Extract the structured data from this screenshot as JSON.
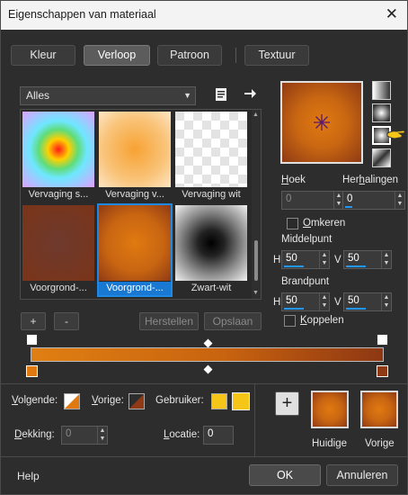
{
  "title": "Eigenschappen van materiaal",
  "close_glyph": "✕",
  "tabs": [
    {
      "label": "Kleur",
      "active": false
    },
    {
      "label": "Verloop",
      "active": true
    },
    {
      "label": "Patroon",
      "active": false
    },
    {
      "label": "Textuur",
      "active": false
    }
  ],
  "category": {
    "selected": "Alles"
  },
  "gallery": [
    {
      "label": "Vervaging s...",
      "selected": false
    },
    {
      "label": "Vervaging v...",
      "selected": false
    },
    {
      "label": "Vervaging wit",
      "selected": false
    },
    {
      "label": "Voorgrond-...",
      "selected": false
    },
    {
      "label": "Voorgrond-...",
      "selected": true
    },
    {
      "label": "Zwart-wit",
      "selected": false
    }
  ],
  "gallery_buttons": {
    "add": "+",
    "remove": "-",
    "restore": "Herstellen",
    "save": "Opslaan"
  },
  "angle": {
    "label_prefix": "H",
    "label_rest": "oek",
    "value": "0"
  },
  "repeats": {
    "label_pre": "Her",
    "label_u": "h",
    "label_post": "alingen",
    "value": "0"
  },
  "reverse": {
    "label_u": "O",
    "label_rest": "mkeren"
  },
  "center": {
    "heading": "Middelpunt",
    "h_label": "H",
    "h_value": "50",
    "v_label": "V",
    "v_value": "50"
  },
  "focal": {
    "heading": "Brandpunt",
    "h_label": "H",
    "h_value": "50",
    "v_label": "V",
    "v_value": "50"
  },
  "link": {
    "label_u": "K",
    "label_rest": "oppelen"
  },
  "bottom": {
    "next_label_u": "V",
    "next_label_rest": "olgende:",
    "prev_label_u": "V",
    "prev_label_rest": "orige:",
    "user_label": "Gebruiker:",
    "opacity_label_u": "D",
    "opacity_label_rest": "ekking:",
    "opacity_value": "0",
    "location_label_u": "L",
    "location_label_rest": "ocatie:",
    "location_value": "0",
    "plus": "+",
    "current_label": "Huidige",
    "previous_label": "Vorige"
  },
  "footer": {
    "help": "Help",
    "ok": "OK",
    "cancel": "Annuleren"
  },
  "colors": {
    "accent": "#1e88e5",
    "orange": "#e07a10",
    "rust": "#8f3a14",
    "yellow": "#f5c518"
  }
}
